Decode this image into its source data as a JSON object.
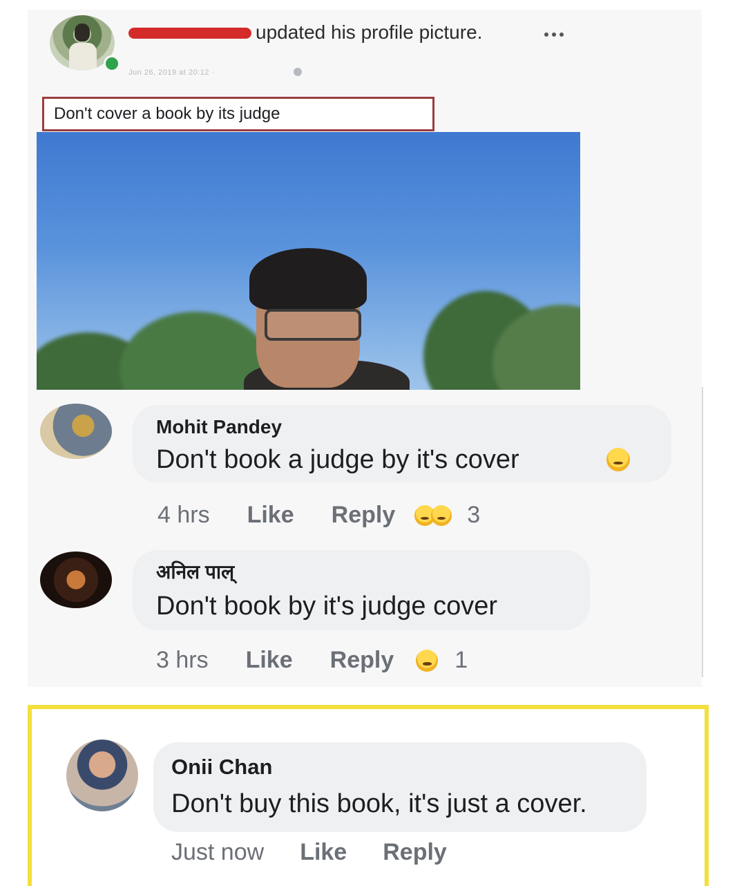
{
  "post": {
    "author_redacted": "",
    "action_text": "updated his profile picture.",
    "meta": "Jun 26, 2019 at 20:12 ·",
    "caption": "Don't cover a book by its judge"
  },
  "comments": [
    {
      "name": "Mohit Pandey",
      "text": "Don't book a judge by it's cover",
      "time": "4 hrs",
      "like": "Like",
      "reply": "Reply",
      "reactions": "3"
    },
    {
      "name": "अनिल पाल्",
      "text": "Don't book by it's judge cover",
      "time": "3 hrs",
      "like": "Like",
      "reply": "Reply",
      "reactions": "1"
    },
    {
      "name": "Onii Chan",
      "text": "Don't buy this book, it's just a cover.",
      "time": "Just now",
      "like": "Like",
      "reply": "Reply"
    }
  ],
  "colors": {
    "highlight_border": "#f3e03b",
    "redaction": "#d42a2a",
    "online": "#31a24c"
  }
}
